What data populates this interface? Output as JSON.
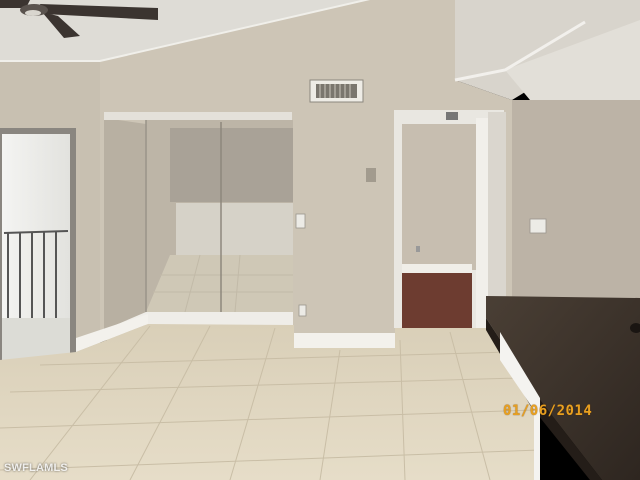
{
  "photo": {
    "watermark": "SWFLAMLS",
    "date_stamp": "01/06/2014"
  }
}
